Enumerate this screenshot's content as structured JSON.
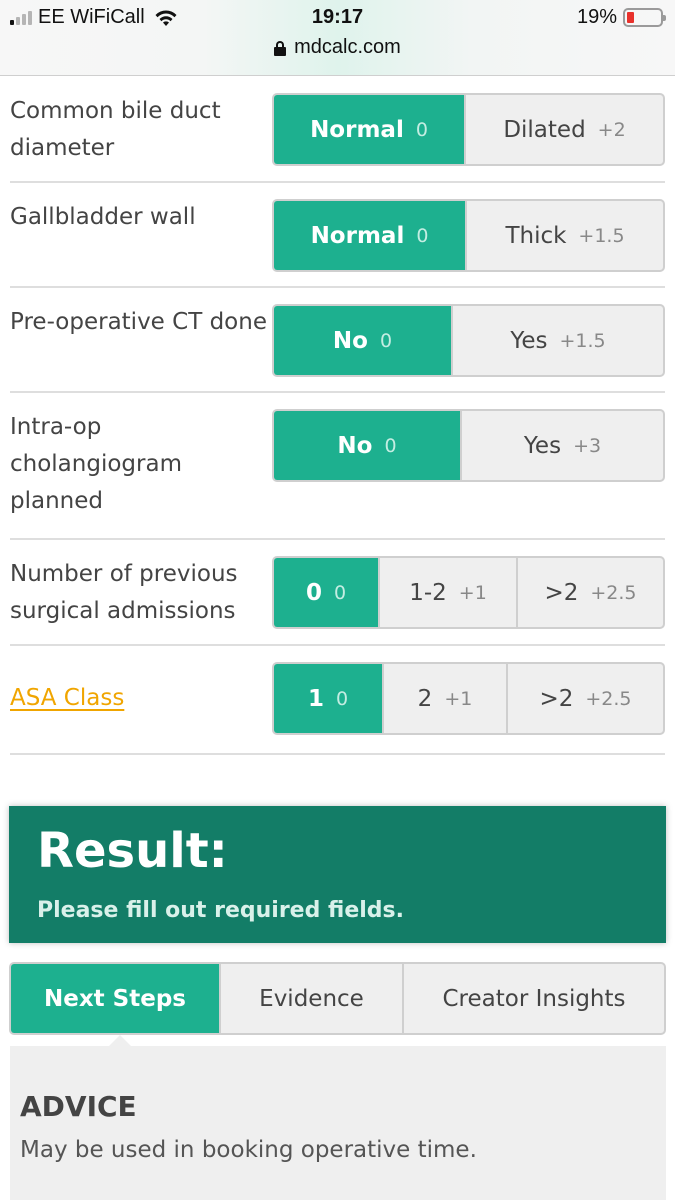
{
  "status_bar": {
    "carrier": "EE WiFiCall",
    "time": "19:17",
    "battery_percent": "19%",
    "battery_level": 0.19,
    "signal_bars_on": 1,
    "signal_bars_total": 4
  },
  "url_bar": {
    "domain": "mdcalc.com"
  },
  "colors": {
    "accent": "#1db08f",
    "result_bg": "#137d67",
    "link": "#f0a500"
  },
  "form": {
    "rows": [
      {
        "label": "Common bile duct diameter",
        "options": [
          {
            "label": "Normal",
            "points": "0",
            "selected": true
          },
          {
            "label": "Dilated",
            "points": "+2",
            "selected": false
          }
        ]
      },
      {
        "label": "Gallbladder wall",
        "options": [
          {
            "label": "Normal",
            "points": "0",
            "selected": true
          },
          {
            "label": "Thick",
            "points": "+1.5",
            "selected": false
          }
        ]
      },
      {
        "label": "Pre-operative CT done",
        "options": [
          {
            "label": "No",
            "points": "0",
            "selected": true
          },
          {
            "label": "Yes",
            "points": "+1.5",
            "selected": false
          }
        ]
      },
      {
        "label": "Intra-op cholangiogram planned",
        "options": [
          {
            "label": "No",
            "points": "0",
            "selected": true
          },
          {
            "label": "Yes",
            "points": "+3",
            "selected": false
          }
        ]
      },
      {
        "label": "Number of previous surgical admissions",
        "options": [
          {
            "label": "0",
            "points": "0",
            "selected": true
          },
          {
            "label": "1-2",
            "points": "+1",
            "selected": false
          },
          {
            "label": ">2",
            "points": "+2.5",
            "selected": false
          }
        ]
      },
      {
        "label": "ASA Class",
        "is_link": true,
        "options": [
          {
            "label": "1",
            "points": "0",
            "selected": true
          },
          {
            "label": "2",
            "points": "+1",
            "selected": false
          },
          {
            "label": ">2",
            "points": "+2.5",
            "selected": false
          }
        ]
      }
    ]
  },
  "result": {
    "title": "Result:",
    "message": "Please fill out required fields."
  },
  "tabs": [
    {
      "label": "Next Steps",
      "active": true
    },
    {
      "label": "Evidence",
      "active": false
    },
    {
      "label": "Creator Insights",
      "active": false
    }
  ],
  "advice": {
    "heading": "ADVICE",
    "text": "May be used in booking operative time."
  }
}
